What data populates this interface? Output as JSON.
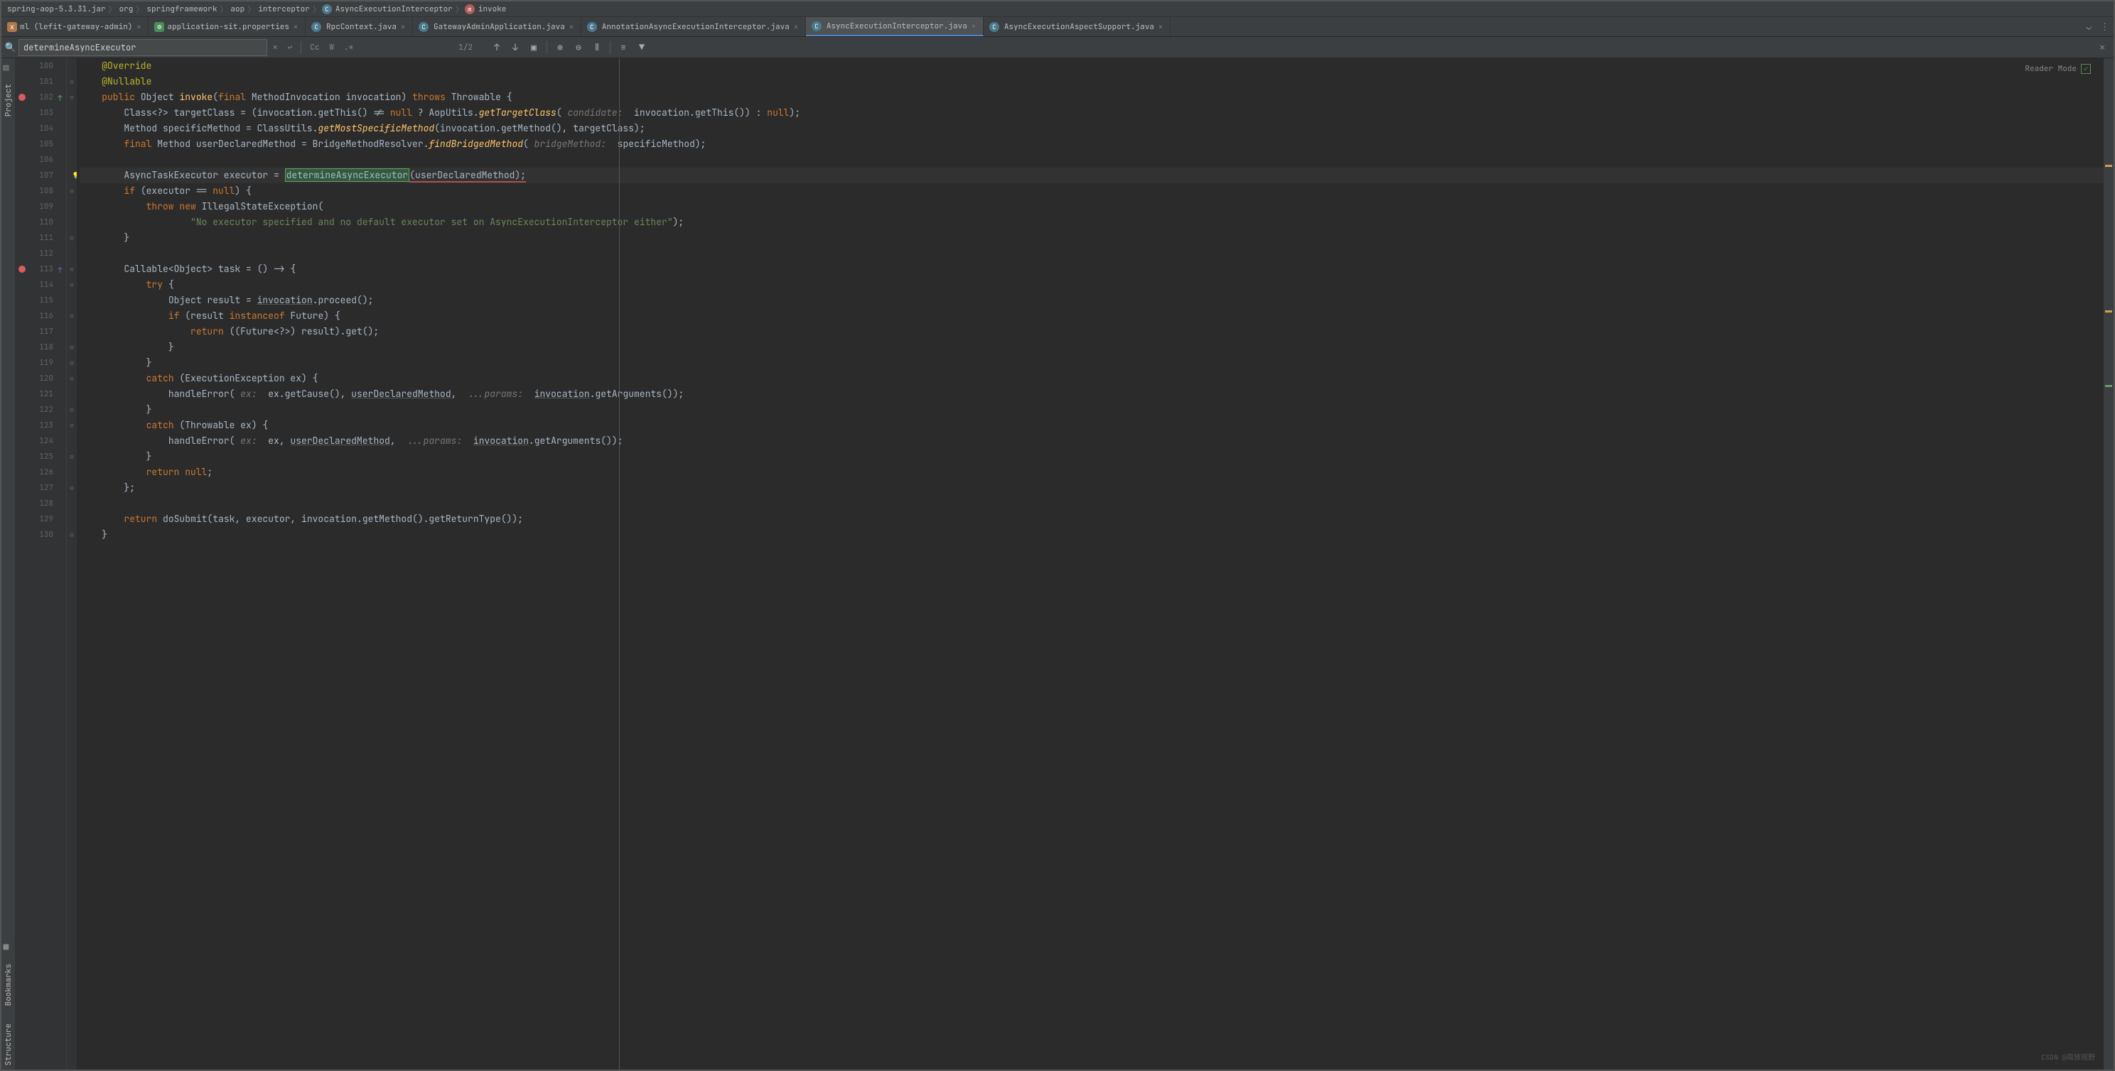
{
  "breadcrumb": {
    "items": [
      "spring-aop-5.3.31.jar",
      "org",
      "springframework",
      "aop",
      "interceptor",
      "AsyncExecutionInterceptor",
      "invoke"
    ],
    "class_icon": "C",
    "method_icon": "m"
  },
  "tabs": {
    "items": [
      {
        "label": "ml (lefit-gateway-admin)",
        "icon": "xml"
      },
      {
        "label": "application-sit.properties",
        "icon": "prop"
      },
      {
        "label": "RpcContext.java",
        "icon": "C"
      },
      {
        "label": "GatewayAdminApplication.java",
        "icon": "C"
      },
      {
        "label": "AnnotationAsyncExecutionInterceptor.java",
        "icon": "C"
      },
      {
        "label": "AsyncExecutionInterceptor.java",
        "icon": "C",
        "active": true
      },
      {
        "label": "AsyncExecutionAspectSupport.java",
        "icon": "C"
      }
    ]
  },
  "find": {
    "query": "determineAsyncExecutor",
    "count": "1/2",
    "cc": "Cc",
    "w": "W",
    "regex": ".*"
  },
  "reader_mode": "Reader Mode",
  "lines": {
    "start": 100,
    "nums": [
      "100",
      "101",
      "102",
      "103",
      "104",
      "105",
      "106",
      "107",
      "108",
      "109",
      "110",
      "111",
      "112",
      "113",
      "114",
      "115",
      "116",
      "117",
      "118",
      "119",
      "120",
      "121",
      "122",
      "123",
      "124",
      "125",
      "126",
      "127",
      "128",
      "129",
      "130"
    ]
  },
  "code": {
    "l100": "@Override",
    "l101": "@Nullable",
    "l102_a": "public",
    "l102_b": " Object ",
    "l102_c": "invoke",
    "l102_d": "(",
    "l102_e": "final",
    "l102_f": " MethodInvocation invocation) ",
    "l102_g": "throws",
    "l102_h": " Throwable {",
    "l103_a": "Class<?> targetClass = (invocation.getThis() != ",
    "l103_b": "null",
    "l103_c": " ? AopUtils.",
    "l103_d": "getTargetClass",
    "l103_e": "(",
    "l103_hint": " candidate: ",
    "l103_f": " invocation.getThis()) : ",
    "l103_g": "null",
    "l103_h": ");",
    "l104_a": "Method specificMethod = ClassUtils.",
    "l104_b": "getMostSpecificMethod",
    "l104_c": "(invocation.getMethod(), targetClass);",
    "l105_a": "final",
    "l105_b": " Method userDeclaredMethod = BridgeMethodResolver.",
    "l105_c": "findBridgedMethod",
    "l105_d": "(",
    "l105_hint": " bridgeMethod: ",
    "l105_e": " specificMethod);",
    "l107_a": "AsyncTaskExecutor executor = ",
    "l107_b": "determineAsyncExecutor",
    "l107_c": "(userDeclaredMethod);",
    "l108_a": "if",
    "l108_b": " (executor == ",
    "l108_c": "null",
    "l108_d": ") {",
    "l109_a": "throw new ",
    "l109_b": "IllegalStateException(",
    "l110_a": "\"No executor specified and no default executor set on AsyncExecutionInterceptor either\"",
    "l110_b": ");",
    "l111": "}",
    "l113_a": "Callable<Object> task = () -> {",
    "l114_a": "try",
    "l114_b": " {",
    "l115_a": "Object result = ",
    "l115_b": "invocation",
    "l115_c": ".proceed();",
    "l116_a": "if",
    "l116_b": " (result ",
    "l116_c": "instanceof",
    "l116_d": " Future) {",
    "l117_a": "return",
    "l117_b": " ((Future<?>) result).get();",
    "l118": "}",
    "l119": "}",
    "l120_a": "catch",
    "l120_b": " (ExecutionException ex) {",
    "l121_a": "handleError(",
    "l121_hint1": " ex: ",
    "l121_b": " ex.getCause(), ",
    "l121_c": "userDeclaredMethod",
    "l121_d": ", ",
    "l121_hint2": " ...params: ",
    "l121_e": "invocation",
    "l121_f": ".getArguments());",
    "l122": "}",
    "l123_a": "catch",
    "l123_b": " (Throwable ex) {",
    "l124_a": "handleError(",
    "l124_hint1": " ex: ",
    "l124_b": " ex, ",
    "l124_c": "userDeclaredMethod",
    "l124_d": ", ",
    "l124_hint2": " ...params: ",
    "l124_e": "invocation",
    "l124_f": ".getArguments());",
    "l125": "}",
    "l126_a": "return ",
    "l126_b": "null",
    "l126_c": ";",
    "l127": "};",
    "l129_a": "return",
    "l129_b": " doSubmit(task, executor, invocation.getMethod().getReturnType());",
    "l130": "}"
  },
  "side": {
    "project": "Project",
    "bookmarks": "Bookmarks",
    "structure": "Structure"
  },
  "watermark": "CSDN @简放视野"
}
